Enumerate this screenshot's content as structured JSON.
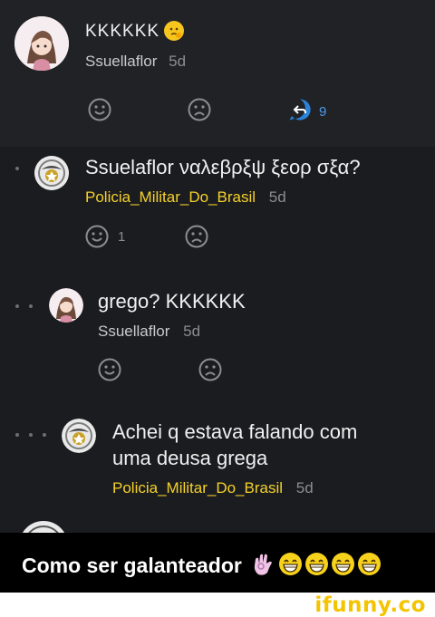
{
  "colors": {
    "bg": "#1b1c20",
    "header_bg": "#212226",
    "username": "#f4d12a",
    "muted": "#8b8d93",
    "reply_blue": "#2b82d9"
  },
  "post": {
    "text": "KKKKKK",
    "author": "Ssuellaflor",
    "time": "5d",
    "reply_count": "9"
  },
  "comments": [
    {
      "text": "Ssuelaflor ναλεβρξψ ξεορ σξα?",
      "author": "Policia_Militar_Do_Brasil",
      "time": "5d",
      "smile_count": "1"
    },
    {
      "text": "grego? KKKKKK",
      "author": "Ssuellaflor",
      "time": "5d"
    },
    {
      "text_line1": "Achei q estava falando com",
      "text_line2": "uma deusa grega",
      "author": "Policia_Militar_Do_Brasil",
      "time": "5d"
    }
  ],
  "caption": {
    "text": "Como ser galanteador"
  },
  "footer": {
    "watermark": "ifunny.co"
  }
}
